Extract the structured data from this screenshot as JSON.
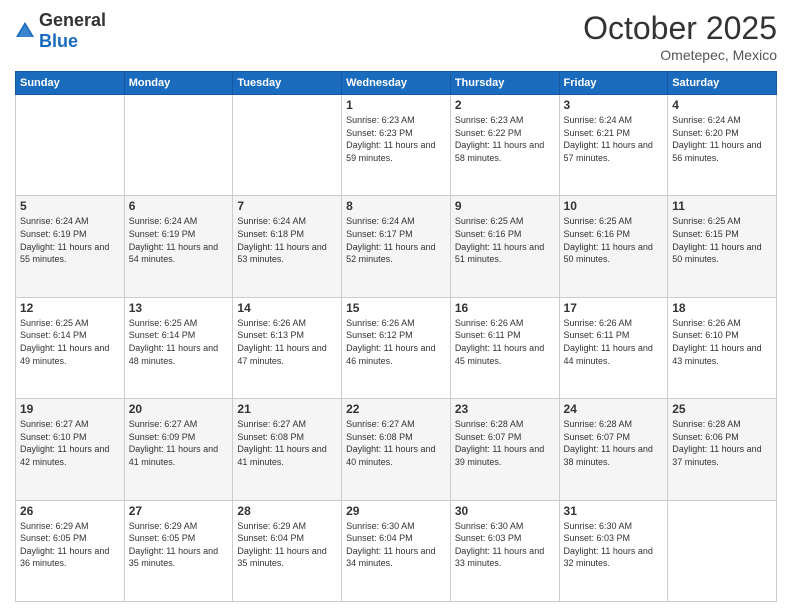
{
  "header": {
    "logo_general": "General",
    "logo_blue": "Blue",
    "month": "October 2025",
    "location": "Ometepec, Mexico"
  },
  "days_of_week": [
    "Sunday",
    "Monday",
    "Tuesday",
    "Wednesday",
    "Thursday",
    "Friday",
    "Saturday"
  ],
  "weeks": [
    [
      {
        "day": "",
        "info": ""
      },
      {
        "day": "",
        "info": ""
      },
      {
        "day": "",
        "info": ""
      },
      {
        "day": "1",
        "info": "Sunrise: 6:23 AM\nSunset: 6:23 PM\nDaylight: 11 hours and 59 minutes."
      },
      {
        "day": "2",
        "info": "Sunrise: 6:23 AM\nSunset: 6:22 PM\nDaylight: 11 hours and 58 minutes."
      },
      {
        "day": "3",
        "info": "Sunrise: 6:24 AM\nSunset: 6:21 PM\nDaylight: 11 hours and 57 minutes."
      },
      {
        "day": "4",
        "info": "Sunrise: 6:24 AM\nSunset: 6:20 PM\nDaylight: 11 hours and 56 minutes."
      }
    ],
    [
      {
        "day": "5",
        "info": "Sunrise: 6:24 AM\nSunset: 6:19 PM\nDaylight: 11 hours and 55 minutes."
      },
      {
        "day": "6",
        "info": "Sunrise: 6:24 AM\nSunset: 6:19 PM\nDaylight: 11 hours and 54 minutes."
      },
      {
        "day": "7",
        "info": "Sunrise: 6:24 AM\nSunset: 6:18 PM\nDaylight: 11 hours and 53 minutes."
      },
      {
        "day": "8",
        "info": "Sunrise: 6:24 AM\nSunset: 6:17 PM\nDaylight: 11 hours and 52 minutes."
      },
      {
        "day": "9",
        "info": "Sunrise: 6:25 AM\nSunset: 6:16 PM\nDaylight: 11 hours and 51 minutes."
      },
      {
        "day": "10",
        "info": "Sunrise: 6:25 AM\nSunset: 6:16 PM\nDaylight: 11 hours and 50 minutes."
      },
      {
        "day": "11",
        "info": "Sunrise: 6:25 AM\nSunset: 6:15 PM\nDaylight: 11 hours and 50 minutes."
      }
    ],
    [
      {
        "day": "12",
        "info": "Sunrise: 6:25 AM\nSunset: 6:14 PM\nDaylight: 11 hours and 49 minutes."
      },
      {
        "day": "13",
        "info": "Sunrise: 6:25 AM\nSunset: 6:14 PM\nDaylight: 11 hours and 48 minutes."
      },
      {
        "day": "14",
        "info": "Sunrise: 6:26 AM\nSunset: 6:13 PM\nDaylight: 11 hours and 47 minutes."
      },
      {
        "day": "15",
        "info": "Sunrise: 6:26 AM\nSunset: 6:12 PM\nDaylight: 11 hours and 46 minutes."
      },
      {
        "day": "16",
        "info": "Sunrise: 6:26 AM\nSunset: 6:11 PM\nDaylight: 11 hours and 45 minutes."
      },
      {
        "day": "17",
        "info": "Sunrise: 6:26 AM\nSunset: 6:11 PM\nDaylight: 11 hours and 44 minutes."
      },
      {
        "day": "18",
        "info": "Sunrise: 6:26 AM\nSunset: 6:10 PM\nDaylight: 11 hours and 43 minutes."
      }
    ],
    [
      {
        "day": "19",
        "info": "Sunrise: 6:27 AM\nSunset: 6:10 PM\nDaylight: 11 hours and 42 minutes."
      },
      {
        "day": "20",
        "info": "Sunrise: 6:27 AM\nSunset: 6:09 PM\nDaylight: 11 hours and 41 minutes."
      },
      {
        "day": "21",
        "info": "Sunrise: 6:27 AM\nSunset: 6:08 PM\nDaylight: 11 hours and 41 minutes."
      },
      {
        "day": "22",
        "info": "Sunrise: 6:27 AM\nSunset: 6:08 PM\nDaylight: 11 hours and 40 minutes."
      },
      {
        "day": "23",
        "info": "Sunrise: 6:28 AM\nSunset: 6:07 PM\nDaylight: 11 hours and 39 minutes."
      },
      {
        "day": "24",
        "info": "Sunrise: 6:28 AM\nSunset: 6:07 PM\nDaylight: 11 hours and 38 minutes."
      },
      {
        "day": "25",
        "info": "Sunrise: 6:28 AM\nSunset: 6:06 PM\nDaylight: 11 hours and 37 minutes."
      }
    ],
    [
      {
        "day": "26",
        "info": "Sunrise: 6:29 AM\nSunset: 6:05 PM\nDaylight: 11 hours and 36 minutes."
      },
      {
        "day": "27",
        "info": "Sunrise: 6:29 AM\nSunset: 6:05 PM\nDaylight: 11 hours and 35 minutes."
      },
      {
        "day": "28",
        "info": "Sunrise: 6:29 AM\nSunset: 6:04 PM\nDaylight: 11 hours and 35 minutes."
      },
      {
        "day": "29",
        "info": "Sunrise: 6:30 AM\nSunset: 6:04 PM\nDaylight: 11 hours and 34 minutes."
      },
      {
        "day": "30",
        "info": "Sunrise: 6:30 AM\nSunset: 6:03 PM\nDaylight: 11 hours and 33 minutes."
      },
      {
        "day": "31",
        "info": "Sunrise: 6:30 AM\nSunset: 6:03 PM\nDaylight: 11 hours and 32 minutes."
      },
      {
        "day": "",
        "info": ""
      }
    ]
  ]
}
